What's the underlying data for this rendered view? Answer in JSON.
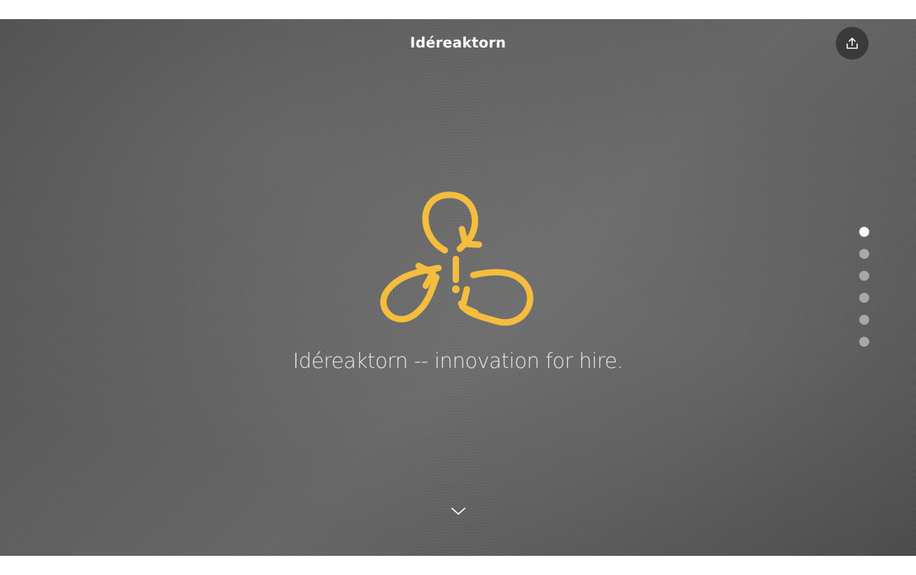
{
  "header": {
    "title": "Idéreaktorn"
  },
  "share": {
    "icon": "share-icon"
  },
  "hero": {
    "logo_icon": "idereaktorn-logo-icon",
    "tagline": "Idéreaktorn -- innovation for hire."
  },
  "pagination": {
    "count": 6,
    "active_index": 0
  },
  "scroll": {
    "icon": "chevron-down-icon"
  },
  "colors": {
    "accent": "#f5bd3d",
    "background": "#5a5a5a",
    "text": "#ffffff"
  }
}
